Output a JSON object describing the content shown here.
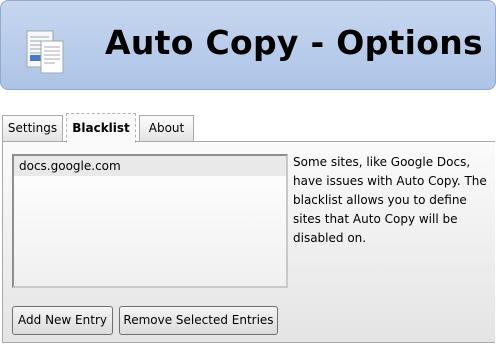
{
  "header": {
    "title": "Auto Copy - Options"
  },
  "tabs": [
    {
      "label": "Settings"
    },
    {
      "label": "Blacklist"
    },
    {
      "label": "About"
    }
  ],
  "blacklist": {
    "entries": [
      "docs.google.com"
    ],
    "description": "Some sites, like Google Docs, have issues with Auto Copy. The blacklist allows you to define sites that Auto Copy will be disabled on.",
    "add_button": "Add New Entry",
    "remove_button": "Remove Selected Entries"
  },
  "active_tab": "Blacklist"
}
